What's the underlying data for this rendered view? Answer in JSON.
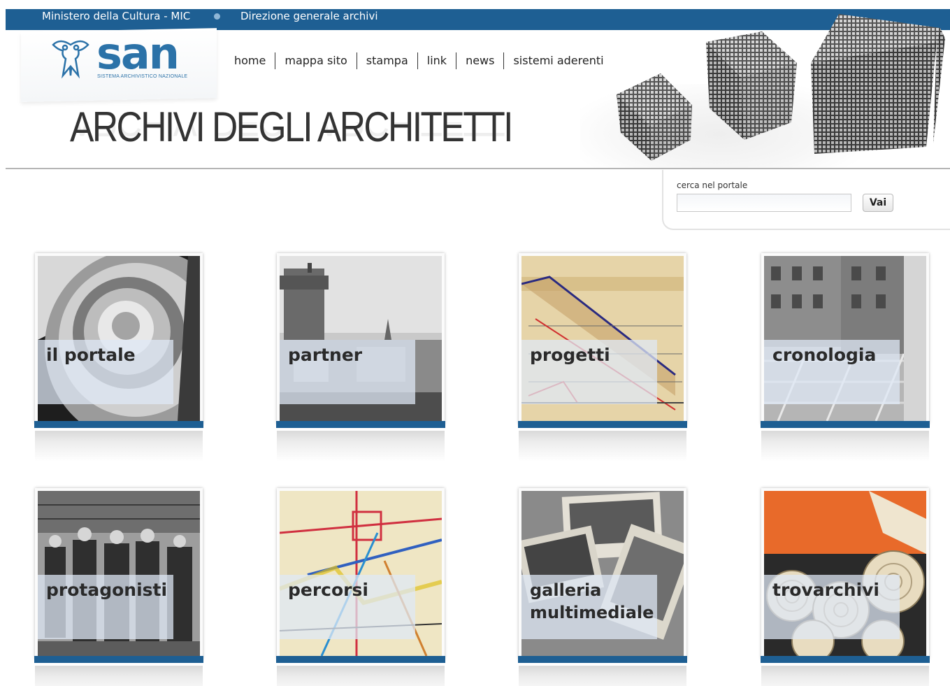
{
  "topbar": {
    "ministry": "Ministero della Cultura - MIC",
    "direzione": "Direzione generale archivi"
  },
  "logo": {
    "text": "san",
    "subtitle": "SISTEMA ARCHIVISTICO NAZIONALE"
  },
  "nav": {
    "items": [
      {
        "label": "home"
      },
      {
        "label": "mappa sito"
      },
      {
        "label": "stampa"
      },
      {
        "label": "link"
      },
      {
        "label": "news"
      },
      {
        "label": "sistemi aderenti"
      }
    ]
  },
  "site_title": "ARCHIVI DEGLI ARCHITETTI",
  "search": {
    "label": "cerca nel portale",
    "value": "",
    "placeholder": "",
    "button_label": "Vai"
  },
  "tiles": [
    {
      "label": "il portale",
      "image": "spiral-staircase"
    },
    {
      "label": "partner",
      "image": "city-skyline-tower"
    },
    {
      "label": "progetti",
      "image": "architectural-drawing"
    },
    {
      "label": "cronologia",
      "image": "building-construction"
    },
    {
      "label": "protagonisti",
      "image": "group-of-men"
    },
    {
      "label": "percorsi",
      "image": "colored-map-plan"
    },
    {
      "label": "galleria multimediale",
      "image": "photo-pile"
    },
    {
      "label": "trovarchivi",
      "image": "rolled-drawings"
    }
  ],
  "colors": {
    "brand_blue": "#1e5f93",
    "logo_blue": "#2b72a8",
    "label_panel": "#dee8f6"
  }
}
